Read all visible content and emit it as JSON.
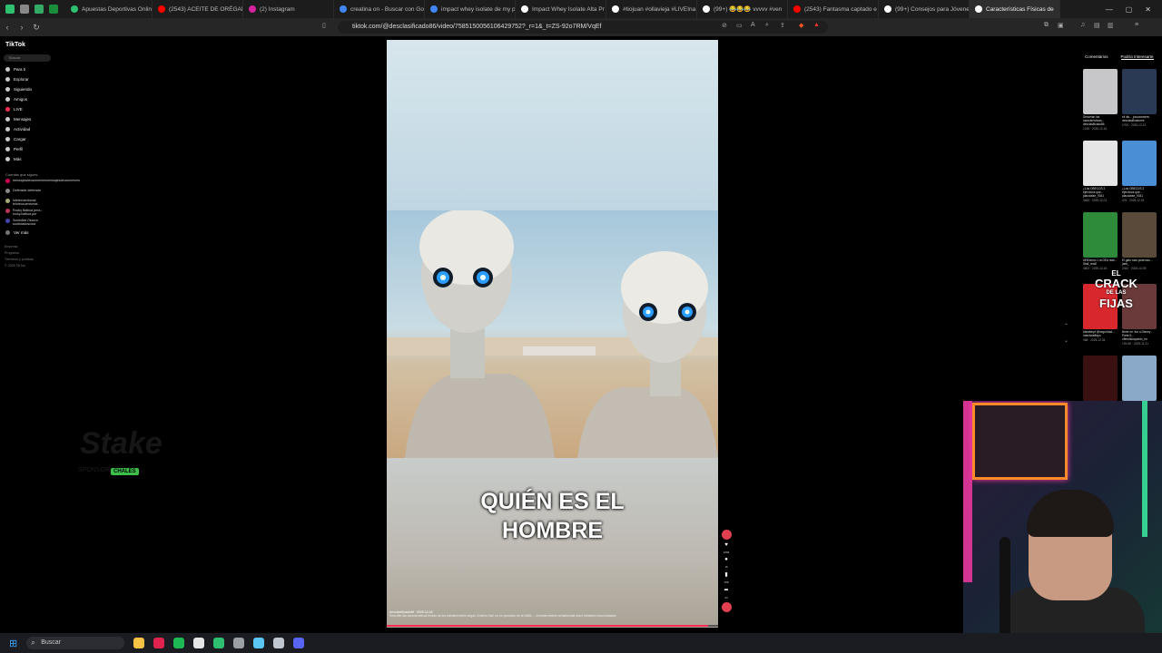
{
  "browser": {
    "tabs": [
      {
        "label": "Apuestas Deportivas Online",
        "favicon_color": "#2fbf71"
      },
      {
        "label": "(2543) ACEITE DE ORÉGANO",
        "favicon_color": "#ff0000"
      },
      {
        "label": "(2) Instagram",
        "favicon_color": "#d6249f"
      },
      {
        "label": "creatina on - Buscar con Go",
        "favicon_color": "#4285f4"
      },
      {
        "label": "impact whey isolate de my p",
        "favicon_color": "#4285f4"
      },
      {
        "label": "Impact Whey Isolate Alta Pr",
        "favicon_color": "#ffffff"
      },
      {
        "label": "#tiojuan #ollavieja #LIVEIna",
        "favicon_color": "#ffffff"
      },
      {
        "label": "(99+) 😂😂😂 vvvvv #ven",
        "favicon_color": "#ffffff"
      },
      {
        "label": "(2543) Fantasma captado e",
        "favicon_color": "#ff0000"
      },
      {
        "label": "(99+) Consejos para Jóvenes",
        "favicon_color": "#ffffff"
      },
      {
        "label": "Características Físicas de",
        "favicon_color": "#ffffff",
        "active": true
      }
    ],
    "url": "tiktok.com/@desclasificado86/video/7585150056106429752?_r=1&_t=ZS-92o7RM/VqEf",
    "window_controls": [
      "—",
      "▢",
      "✕"
    ]
  },
  "tiktok": {
    "logo": "TikTok",
    "search_placeholder": "Buscar",
    "nav": [
      "Para ti",
      "Explorar",
      "Siguiendo",
      "Amigos",
      "LIVE",
      "Mensajes",
      "Actividad",
      "Cargar",
      "Perfil",
      "Más"
    ],
    "following_title": "Cuentas que sigues",
    "following": [
      "mensajesdeosomemesmensajesdeosomemes",
      "Defensde defensde",
      "lotetecuentomal teloteocuentomal",
      "Rocky Balboa pera... rocky.balboa.por",
      "Sociedad Oscura sociedadoscura"
    ],
    "see_more": "Ver más",
    "footer": [
      "Empresa",
      "Programa",
      "Términos y políticas",
      "© 2025 TikTok"
    ],
    "video": {
      "caption_line1": "QUIÉN ES EL",
      "caption_line2": "HOMBRE",
      "author_line": "desclasificado86 · 2025-12-18",
      "description": "Describe las características físicas de los extraterrestres según Charles Hall, un ex operador de la Nellis ... #extraterrestres #charleshall #ovni #misterio #curiosidades",
      "progress": 0.97,
      "counts": {
        "likes": "1096",
        "comments": "16",
        "saves": "168",
        "shares": "24"
      }
    },
    "right_tabs": [
      "Comentarios",
      "Podría Interesarte"
    ],
    "related": [
      {
        "caption": "Desvelan las características... desclasificado86",
        "meta": "1245 · 2025-12-16",
        "color": "#c7c7c9"
      },
      {
        "caption": "ell diu... jusooonstres desclasificadores",
        "meta": "1700 · 2025-12-13",
        "color": "#2a3a54"
      },
      {
        "caption": "¿Los OBECOS 2 ejercicios que... jdacolaise_9341",
        "meta": "4460 · 2025-12-01",
        "color": "#e5e5e5"
      },
      {
        "caption": "¿Los OBECOS 2 ejercicios que... jdacolaise_9341",
        "meta": "476 · 2025-12-01",
        "color": "#4a8fd6"
      },
      {
        "caption": "#ElExterio 1 la DEA reali... Stall_real0",
        "meta": "4602 · 2025-12-16",
        "color": "#2e8b3a"
      },
      {
        "caption": "El gato mas poderoso... jaeb_",
        "meta": "2042 · 2025-12-05",
        "color": "#5a4a3a"
      },
      {
        "caption": "#beatimpt @seguridad... mandaraffapo",
        "meta": "468 · 2025-12-04",
        "color": "#d8282e"
      },
      {
        "caption": "Bebe mr. fue a Disney - Parte 5... offendidospablo_en",
        "meta": "129.6K · 2025-11-21",
        "color": "#6a3a3a"
      },
      {
        "caption": "",
        "meta": "",
        "color": "#3a1010"
      },
      {
        "caption": "",
        "meta": "",
        "color": "#8aa8c8"
      }
    ],
    "overlay_text": [
      "EL",
      "CRACK",
      "DE LAS",
      "FIJAS"
    ]
  },
  "stream": {
    "brand": "Stake",
    "partner": "CHALES",
    "partner_prefix": "SPONSOR"
  },
  "taskbar": {
    "search_label": "Buscar",
    "apps": [
      "#f6c344",
      "#e0234e",
      "#1db954",
      "#e6e6e6",
      "#2fbf71",
      "#9aa0a6",
      "#5cc6f2",
      "#c0c6d0",
      "#5865f2"
    ]
  }
}
